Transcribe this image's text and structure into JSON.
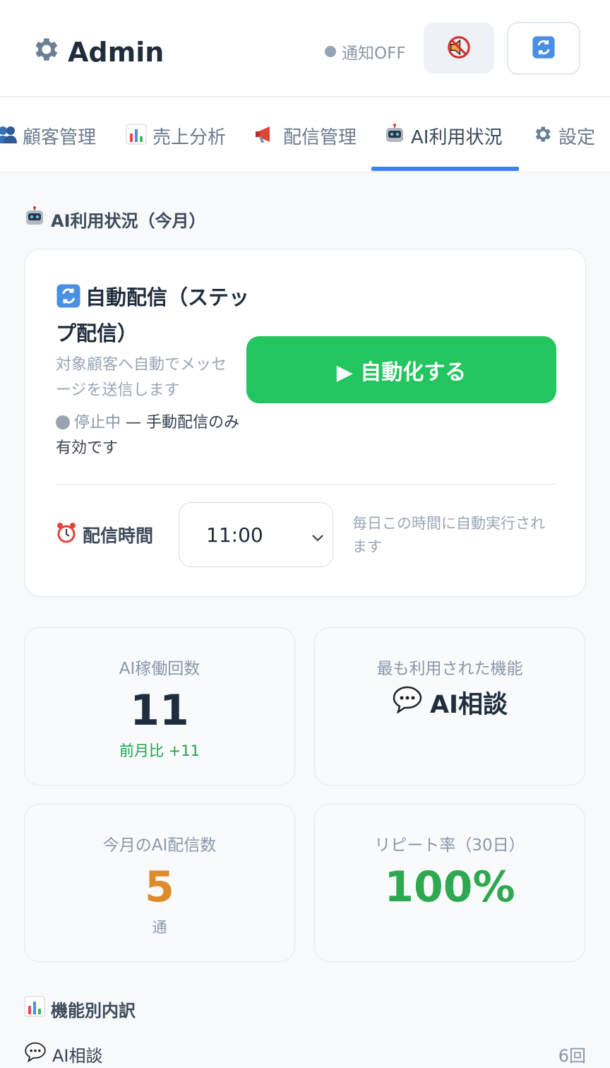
{
  "header": {
    "title": "Admin",
    "icon": "gear-icon",
    "notify_status": "通知OFF",
    "mute_icon": "muted-speaker-icon",
    "refresh_icon": "refresh-icon"
  },
  "tabs": [
    {
      "label": "顧客管理",
      "icon": "people-icon",
      "active": false
    },
    {
      "label": "売上分析",
      "icon": "bar-chart-icon",
      "active": false
    },
    {
      "label": "配信管理",
      "icon": "megaphone-icon",
      "active": false
    },
    {
      "label": "AI利用状況",
      "icon": "robot-icon",
      "active": true
    },
    {
      "label": "設定",
      "icon": "gear-icon",
      "active": false
    }
  ],
  "section_title": "AI利用状況（今月）",
  "auto_delivery": {
    "title": "自動配信（ステップ配信）",
    "description": "対象顧客へ自動でメッセージを送信します",
    "status_label": "停止中",
    "status_note": "— 手動配信のみ有効です",
    "button_label": "▶ 自動化する",
    "time_label": "配信時間",
    "time_value": "11:00",
    "time_note": "毎日この時間に自動実行されます"
  },
  "stats": {
    "ai_runs": {
      "label": "AI稼働回数",
      "value": "11",
      "sub": "前月比 +11"
    },
    "top_feature": {
      "label": "最も利用された機能",
      "value": "AI相談"
    },
    "ai_deliveries": {
      "label": "今月のAI配信数",
      "value": "5",
      "sub": "通"
    },
    "repeat_rate": {
      "label": "リピート率（30日）",
      "value": "100%"
    }
  },
  "breakdown": {
    "title": "機能別内訳",
    "items": [
      {
        "label": "AI相談",
        "value": "6回"
      }
    ]
  },
  "colors": {
    "accent": "#3b82f6",
    "success": "#22c55e",
    "orange": "#e08a2c",
    "green_text": "#2fa84f"
  }
}
